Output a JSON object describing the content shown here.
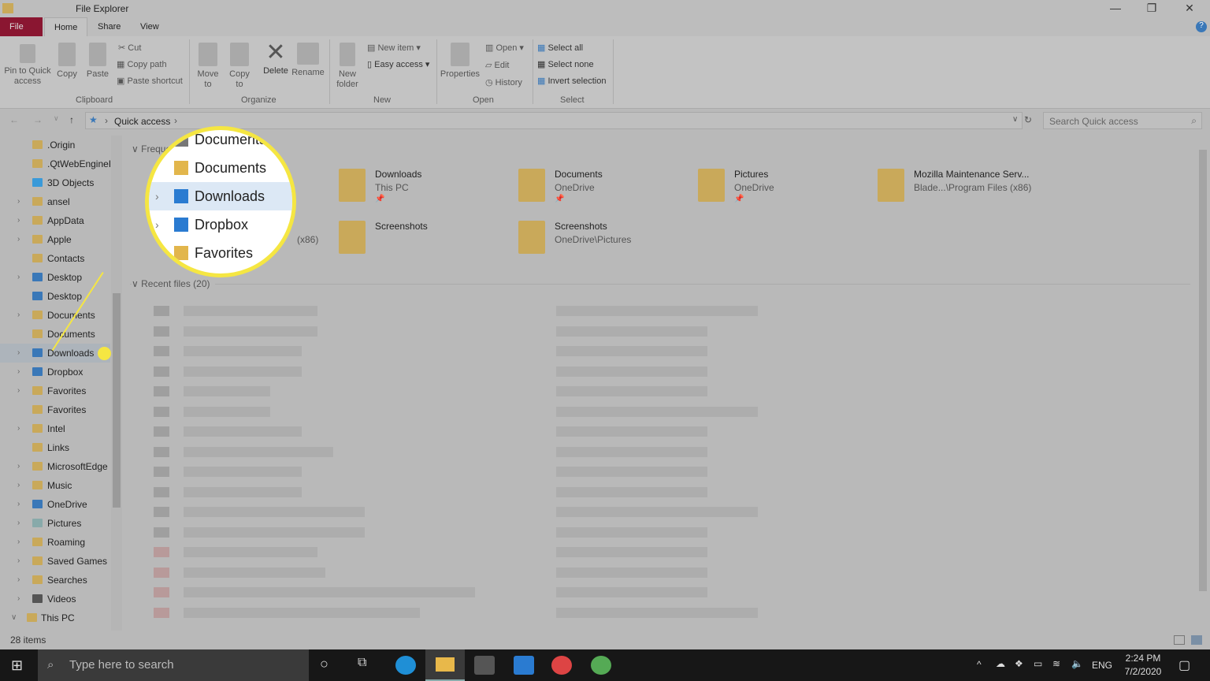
{
  "window": {
    "title": "File Explorer",
    "minimize": "—",
    "maximize": "❐",
    "close": "✕"
  },
  "tabs": [
    "File",
    "Home",
    "Share",
    "View"
  ],
  "ribbon": {
    "clipboard": {
      "pin": "Pin to Quick access",
      "copy": "Copy",
      "paste": "Paste",
      "cut": "Cut",
      "copy_path": "Copy path",
      "paste_shortcut": "Paste shortcut",
      "label": "Clipboard"
    },
    "organize": {
      "move_to": "Move to",
      "copy_to": "Copy to",
      "delete": "Delete",
      "rename": "Rename",
      "label": "Organize"
    },
    "new": {
      "new_folder": "New folder",
      "new_item": "New item",
      "easy_access": "Easy access",
      "label": "New"
    },
    "open": {
      "properties": "Properties",
      "open": "Open",
      "edit": "Edit",
      "history": "History",
      "label": "Open"
    },
    "select": {
      "select_all": "Select all",
      "select_none": "Select none",
      "invert": "Invert selection",
      "label": "Select"
    }
  },
  "address": {
    "path": "Quick access",
    "search_placeholder": "Search Quick access"
  },
  "sidebar": [
    ".Origin",
    ".QtWebEngineP",
    "3D Objects",
    "ansel",
    "AppData",
    "Apple",
    "Contacts",
    "Desktop",
    "Desktop",
    "Documents",
    "Documents",
    "Downloads",
    "Dropbox",
    "Favorites",
    "Favorites",
    "Intel",
    "Links",
    "MicrosoftEdge",
    "Music",
    "OneDrive",
    "Pictures",
    "Roaming",
    "Saved Games",
    "Searches",
    "Videos",
    "This PC"
  ],
  "frequent": {
    "header": "Frequent folders",
    "items": [
      {
        "name": "Downloads",
        "sub": "This PC"
      },
      {
        "name": "Documents",
        "sub": "OneDrive"
      },
      {
        "name": "Pictures",
        "sub": "OneDrive"
      },
      {
        "name": "Mozilla Maintenance Serv...",
        "sub": "Blade...\\Program Files (x86)"
      },
      {
        "name": "Screenshots",
        "sub": ""
      },
      {
        "name": "Screenshots",
        "sub": "OneDrive\\Pictures"
      }
    ],
    "partial_sub": "(x86)"
  },
  "recent": {
    "header": "Recent files (20)"
  },
  "status": {
    "count": "28 items"
  },
  "magnifier": [
    "Documents",
    "Documents",
    "Downloads",
    "Dropbox",
    "Favorites"
  ],
  "taskbar": {
    "search": "Type here to search",
    "lang": "ENG",
    "time": "2:24 PM",
    "date": "7/2/2020"
  }
}
